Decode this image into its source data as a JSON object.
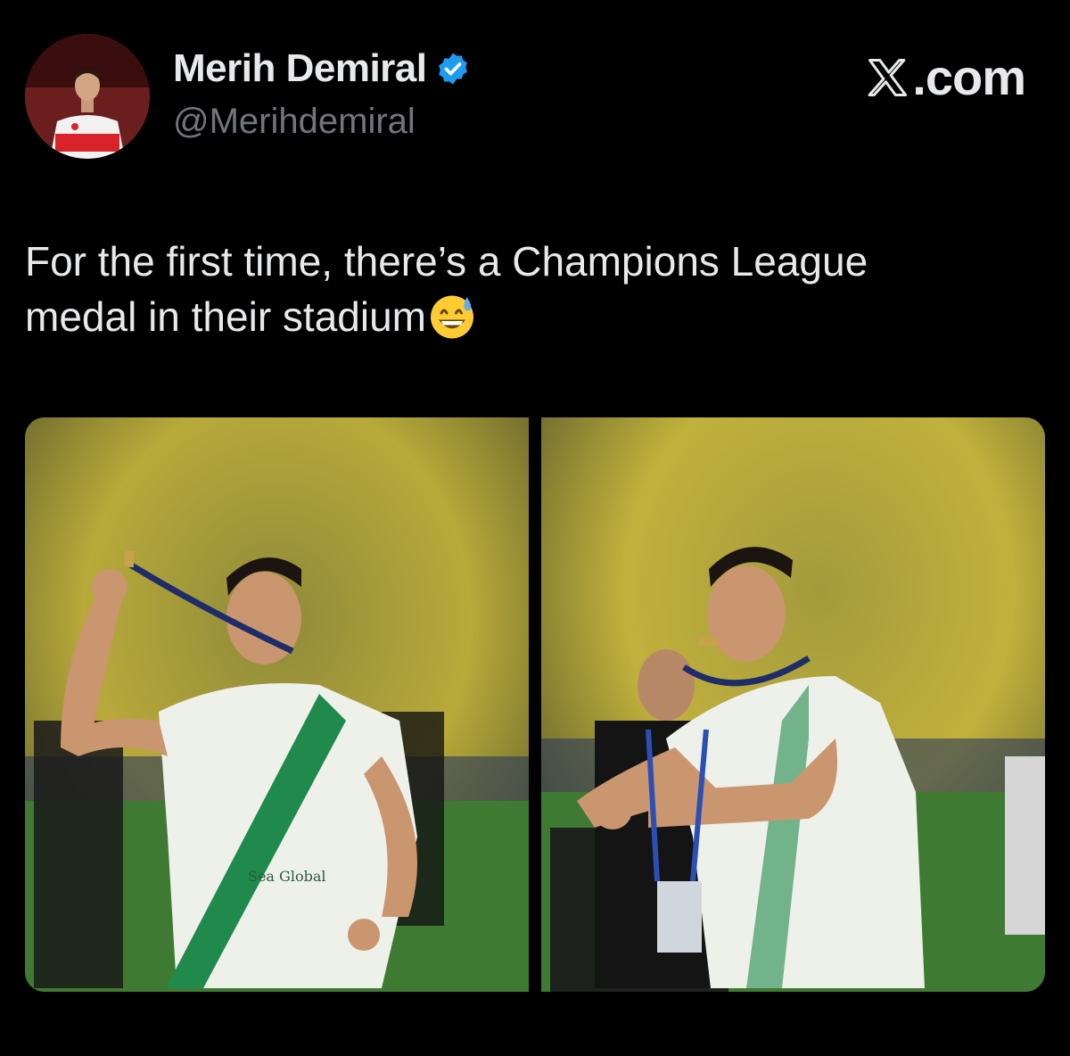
{
  "author": {
    "display_name": "Merih Demiral",
    "handle": "@Merihdemiral",
    "verified": true,
    "avatar_icon": "profile-photo"
  },
  "brand": {
    "text": ".com",
    "logo_icon": "x-logo-icon"
  },
  "tweet": {
    "line1": "For the first time, there’s a Champions League",
    "line2": "medal in their stadium",
    "emoji": "grinning-face-with-sweat"
  },
  "media": {
    "photos": [
      {
        "label": "photo-1"
      },
      {
        "label": "photo-2"
      }
    ],
    "jersey_text": "Sea Global"
  },
  "colors": {
    "background": "#000000",
    "text_primary": "#e7e9ea",
    "text_secondary": "#71767b",
    "verified_blue": "#1d9bf0",
    "stadium_yellow": "#c9b63a",
    "pitch_green": "#4f8a3a",
    "jersey_white": "#eef0ea",
    "jersey_green": "#1f8a4c"
  }
}
